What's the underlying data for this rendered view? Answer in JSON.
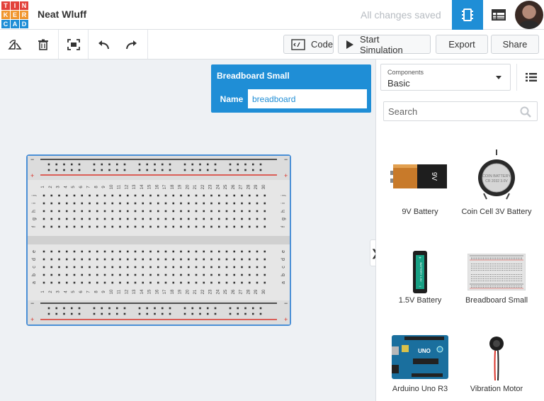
{
  "header": {
    "logo_letters": [
      "T",
      "I",
      "N",
      "K",
      "E",
      "R",
      "C",
      "A",
      "D"
    ],
    "logo_colors": [
      "#e2413b",
      "#e2413b",
      "#e2413b",
      "#f0962e",
      "#f0962e",
      "#f0962e",
      "#1f8ed6",
      "#1f8ed6",
      "#1f8ed6"
    ],
    "project_title": "Neat Wluff",
    "save_status": "All changes saved"
  },
  "toolbar": {
    "code_label": "Code",
    "simulate_label": "Start Simulation",
    "export_label": "Export",
    "share_label": "Share"
  },
  "inspector": {
    "title": "Breadboard Small",
    "name_label": "Name",
    "name_value": "breadboard"
  },
  "breadboard": {
    "columns": [
      "1",
      "2",
      "3",
      "4",
      "5",
      "6",
      "7",
      "8",
      "9",
      "10",
      "11",
      "12",
      "13",
      "14",
      "15",
      "16",
      "17",
      "18",
      "19",
      "20",
      "21",
      "22",
      "23",
      "24",
      "25",
      "26",
      "27",
      "28",
      "29",
      "30"
    ],
    "top_rows": [
      "j",
      "i",
      "h",
      "g",
      "f"
    ],
    "bottom_rows": [
      "e",
      "d",
      "c",
      "b",
      "a"
    ],
    "rail_minus": "−",
    "rail_plus": "+"
  },
  "panel": {
    "components_label": "Components",
    "components_value": "Basic",
    "search_placeholder": "Search",
    "toggle_glyph": "❯",
    "items": [
      {
        "label": "9V Battery",
        "icon": "9v-battery-icon",
        "battery_text": "9V"
      },
      {
        "label": "Coin Cell 3V Battery",
        "icon": "coin-cell-battery-icon",
        "battery_text": "COIN BATTERY CR 2032 3.0V"
      },
      {
        "label": "1.5V Battery",
        "icon": "aa-battery-icon",
        "battery_text": "BATTERY 1.5V"
      },
      {
        "label": "Breadboard Small",
        "icon": "breadboard-icon"
      },
      {
        "label": "Arduino Uno R3",
        "icon": "arduino-uno-icon",
        "board_text": "UNO"
      },
      {
        "label": "Vibration Motor",
        "icon": "vibration-motor-icon"
      }
    ]
  },
  "colors": {
    "accent": "#1f8ed6",
    "rail_red": "#d9342b"
  }
}
